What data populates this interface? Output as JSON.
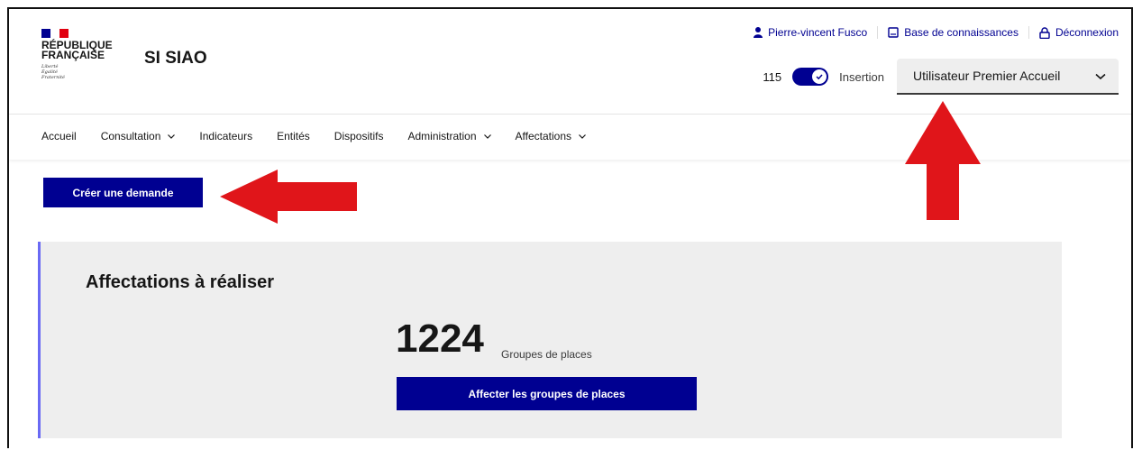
{
  "colors": {
    "primary": "#000091",
    "accent": "#6a6af4",
    "arrow": "#e0151a",
    "flag_blue": "#000091",
    "flag_white": "#ffffff",
    "flag_red": "#e1000f"
  },
  "logo": {
    "title": "RÉPUBLIQUE\nFRANÇAISE",
    "motto": "Liberté\nÉgalité\nFraternité"
  },
  "service_name": "SI SIAO",
  "top_links": [
    {
      "icon": "user-icon",
      "label": "Pierre-vincent Fusco"
    },
    {
      "icon": "book-icon",
      "label": "Base de connaissances"
    },
    {
      "icon": "lock-icon",
      "label": "Déconnexion"
    }
  ],
  "switch": {
    "left_label": "115",
    "right_label": "Insertion",
    "checked": true
  },
  "profile_select": {
    "value": "Utilisateur Premier Accueil",
    "icon": "chevron-down-icon"
  },
  "nav": [
    {
      "label": "Accueil",
      "has_menu": false
    },
    {
      "label": "Consultation",
      "has_menu": true
    },
    {
      "label": "Indicateurs",
      "has_menu": false
    },
    {
      "label": "Entités",
      "has_menu": false
    },
    {
      "label": "Dispositifs",
      "has_menu": false
    },
    {
      "label": "Administration",
      "has_menu": true
    },
    {
      "label": "Affectations",
      "has_menu": true
    }
  ],
  "create_button": "Créer une demande",
  "panel": {
    "title": "Affectations à réaliser",
    "count": "1224",
    "count_label": "Groupes de places",
    "button": "Affecter les groupes de places"
  }
}
